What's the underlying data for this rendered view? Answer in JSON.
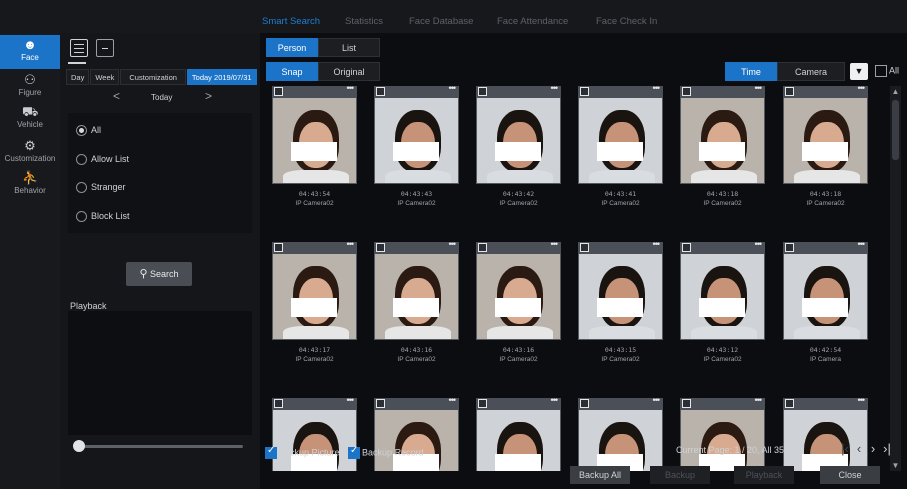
{
  "top_nav": {
    "tabs": [
      {
        "label": "Smart Search",
        "active": true
      },
      {
        "label": "Statistics",
        "active": false
      },
      {
        "label": "Face Database",
        "active": false
      },
      {
        "label": "Face Attendance",
        "active": false
      },
      {
        "label": "Face Check In",
        "active": false
      }
    ]
  },
  "rail": {
    "items": [
      {
        "label": "Face",
        "icon": "face-icon",
        "active": true
      },
      {
        "label": "Figure",
        "icon": "figure-icon",
        "active": false
      },
      {
        "label": "Vehicle",
        "icon": "vehicle-icon",
        "active": false
      },
      {
        "label": "Customization",
        "icon": "customization-icon",
        "active": false
      },
      {
        "label": "Behavior",
        "icon": "behavior-icon",
        "active": false
      }
    ]
  },
  "left_panel": {
    "range_tabs": [
      {
        "label": "Day",
        "active": false
      },
      {
        "label": "Week",
        "active": false
      },
      {
        "label": "Customization",
        "active": false
      },
      {
        "label": "Today 2019/07/31",
        "active": true
      }
    ],
    "date_nav": {
      "prev": "<",
      "label": "Today",
      "next": ">"
    },
    "radio_options": [
      {
        "label": "All",
        "checked": true
      },
      {
        "label": "Allow List",
        "checked": false
      },
      {
        "label": "Stranger",
        "checked": false
      },
      {
        "label": "Block List",
        "checked": false
      }
    ],
    "search_label": "Search",
    "playback_label": "Playback",
    "playback_progress": 0
  },
  "results": {
    "mode_tabs": [
      {
        "label": "Person",
        "active": true
      },
      {
        "label": "List",
        "active": false
      }
    ],
    "image_tabs": [
      {
        "label": "Snap",
        "active": true
      },
      {
        "label": "Original",
        "active": false
      }
    ],
    "sort_tabs": [
      {
        "label": "Time",
        "active": true
      },
      {
        "label": "Camera",
        "active": false
      }
    ],
    "all_label": "All",
    "cards": [
      {
        "time": "04:43:54",
        "camera": "IP Camera02",
        "tone": "female"
      },
      {
        "time": "04:43:43",
        "camera": "IP Camera02",
        "tone": "male"
      },
      {
        "time": "04:43:42",
        "camera": "IP Camera02",
        "tone": "male"
      },
      {
        "time": "04:43:41",
        "camera": "IP Camera02",
        "tone": "male"
      },
      {
        "time": "04:43:18",
        "camera": "IP Camera02",
        "tone": "female"
      },
      {
        "time": "04:43:18",
        "camera": "IP Camera02",
        "tone": "female"
      },
      {
        "time": "04:43:17",
        "camera": "IP Camera02",
        "tone": "female"
      },
      {
        "time": "04:43:16",
        "camera": "IP Camera02",
        "tone": "female"
      },
      {
        "time": "04:43:16",
        "camera": "IP Camera02",
        "tone": "female"
      },
      {
        "time": "04:43:15",
        "camera": "IP Camera02",
        "tone": "male"
      },
      {
        "time": "04:43:12",
        "camera": "IP Camera02",
        "tone": "male"
      },
      {
        "time": "04:42:54",
        "camera": "IP Camera",
        "tone": "male"
      },
      {
        "time": "",
        "camera": "",
        "tone": "male"
      },
      {
        "time": "",
        "camera": "",
        "tone": "female"
      },
      {
        "time": "",
        "camera": "",
        "tone": "male"
      },
      {
        "time": "",
        "camera": "",
        "tone": "male"
      },
      {
        "time": "",
        "camera": "",
        "tone": "female"
      },
      {
        "time": "",
        "camera": "",
        "tone": "male"
      }
    ],
    "backup_picture_label": "Backup Picture",
    "backup_record_label": "Backup Record",
    "page_info": "Current Page: 1 / 20, All 352",
    "buttons": {
      "backup_all": "Backup All",
      "backup": "Backup",
      "playback": "Playback",
      "close": "Close"
    }
  },
  "colors": {
    "accent": "#1c74c8",
    "background": "#0c0d10"
  }
}
